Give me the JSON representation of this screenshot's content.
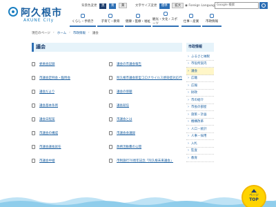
{
  "logo": {
    "name": "阿久根市",
    "sub": "AKUNE City"
  },
  "utility": {
    "bgcolor_label": "背景色変更",
    "bgcolor_options": [
      "黒",
      "青",
      "黄"
    ],
    "fontsize_label": "文字サイズ変更",
    "fontsize_options": [
      "標準",
      "拡大"
    ],
    "lang_label": "Foreign Language",
    "search_placeholder": "Google 検索"
  },
  "gnav": [
    "くらし・手続き",
    "子育て・教育",
    "健康・医療・福祉",
    "観光・文化・スポーツ",
    "仕事・産業",
    "市政情報"
  ],
  "breadcrumb": {
    "current_label": "現在のページ",
    "items": [
      "ホーム",
      "市政情報",
      "議会"
    ]
  },
  "main": {
    "title": "議会",
    "items": [
      "委員会記録",
      "議会の市議会報告",
      "市議会定例会・臨時会",
      "阿久根市議会新型コロナウイルス感染症対応行動などについて",
      "議会だより",
      "議会の傍聴",
      "議会基本条例",
      "議長就任",
      "議会日程案",
      "市議会とは",
      "市議会の構成",
      "市議会会議録",
      "市議会議長就任",
      "政務活動費の公開",
      "市議会中継",
      "市制施行70周年記念「阿久根未来議会」"
    ]
  },
  "sidebar": {
    "title": "市政情報",
    "items": [
      "ふるさと納税",
      "市役所案内",
      "議会",
      "広聴",
      "広報",
      "財政",
      "市の紹介",
      "市長の部屋",
      "施策・計画",
      "機構改革",
      "人口・統計",
      "人事・採用",
      "入札",
      "監査",
      "教育"
    ],
    "active_index": 2
  },
  "pagetop": {
    "line1": "ページ",
    "line2": "TOP"
  },
  "colors": {
    "accent": "#2d6fb5",
    "navy": "#1d3e6e",
    "highlight": "#ffd400"
  }
}
